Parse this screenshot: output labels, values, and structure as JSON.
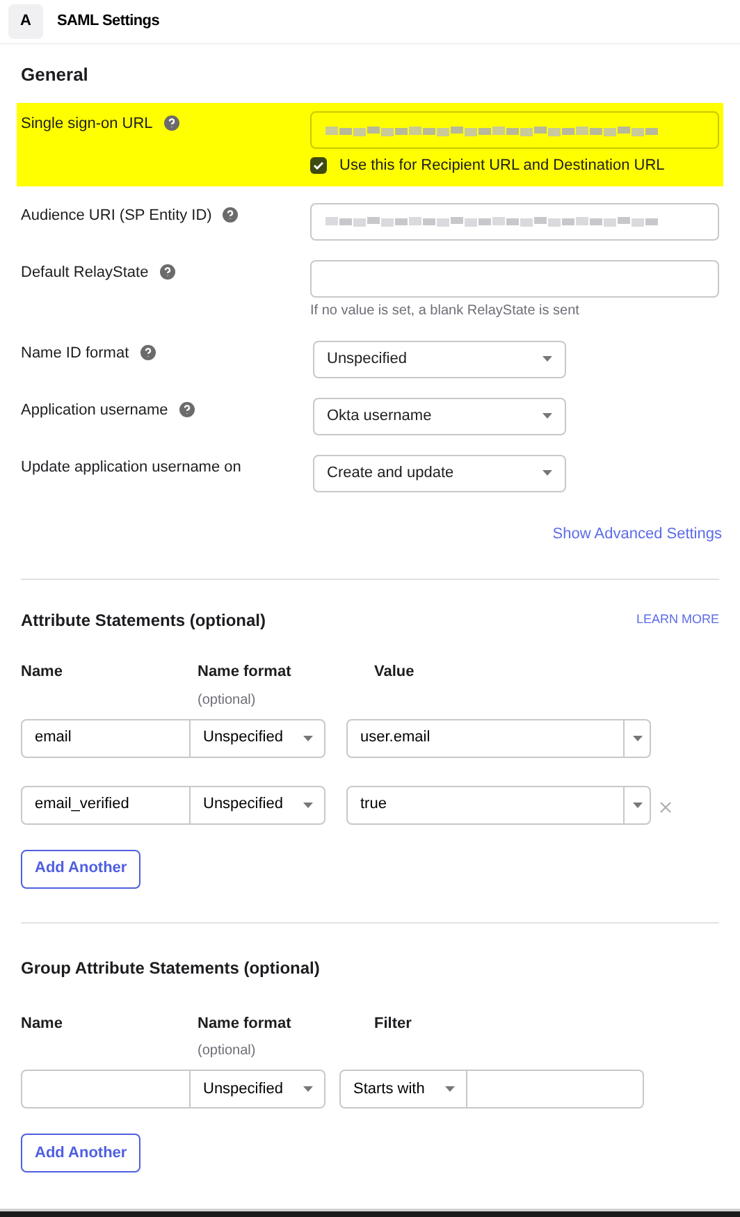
{
  "header": {
    "badge": "A",
    "title": "SAML Settings"
  },
  "general": {
    "heading": "General",
    "fields": [
      {
        "kind": "text",
        "label": "Single sign-on URL",
        "help": true,
        "highlighted": true,
        "blurred": true,
        "checkbox": {
          "label": "Use this for Recipient URL and Destination URL",
          "checked": true
        }
      },
      {
        "kind": "text",
        "label": "Audience URI (SP Entity ID)",
        "help": true,
        "highlighted": false,
        "blurred": true
      },
      {
        "kind": "text",
        "label": "Default RelayState",
        "help": true,
        "highlighted": false,
        "blurred": false,
        "hint": "If no value is set, a blank RelayState is sent"
      },
      {
        "kind": "select",
        "label": "Name ID format",
        "help": true,
        "highlighted": false,
        "value": "Unspecified"
      },
      {
        "kind": "select",
        "label": "Application username",
        "help": true,
        "highlighted": false,
        "value": "Okta username"
      },
      {
        "kind": "select",
        "label": "Update application username on",
        "help": false,
        "highlighted": false,
        "value": "Create and update"
      }
    ],
    "advanced_link": "Show Advanced Settings"
  },
  "attributes": {
    "heading": "Attribute Statements (optional)",
    "learn_more": "LEARN MORE",
    "columns": [
      {
        "label": "Name"
      },
      {
        "label": "Name format",
        "sub": "(optional)"
      },
      {
        "label": "Value"
      }
    ],
    "rows": [
      {
        "name": "email",
        "format": "Unspecified",
        "value": "user.email",
        "removable": false
      },
      {
        "name": "email_verified",
        "format": "Unspecified",
        "value": "true",
        "removable": true
      }
    ],
    "add_button": "Add Another"
  },
  "group_attributes": {
    "heading": "Group Attribute Statements (optional)",
    "columns": [
      {
        "label": "Name"
      },
      {
        "label": "Name format",
        "sub": "(optional)"
      },
      {
        "label": "Filter"
      }
    ],
    "rows": [
      {
        "name": "",
        "format": "Unspecified",
        "filter": "Starts with",
        "filter_value": ""
      }
    ],
    "add_button": "Add Another"
  }
}
